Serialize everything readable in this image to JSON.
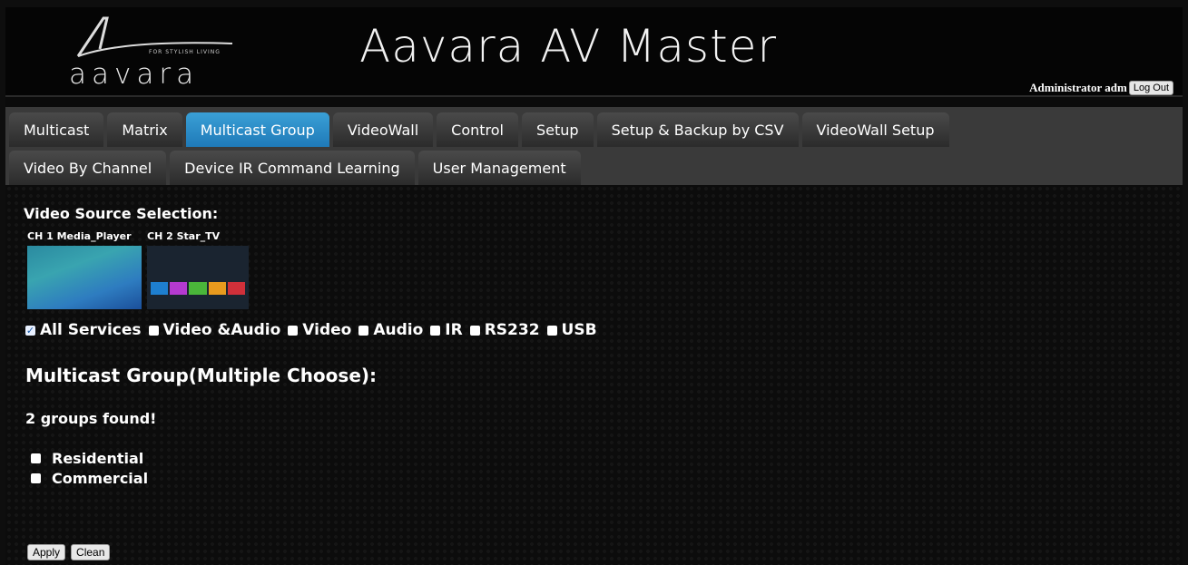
{
  "header": {
    "logo_text": "aavara",
    "logo_tagline": "FOR STYLISH LIVING",
    "title": "Aavara AV Master",
    "admin_text": "Administrator adm",
    "logout_label": "Log Out"
  },
  "tabs": {
    "row1": [
      "Multicast",
      "Matrix",
      "Multicast Group",
      "VideoWall",
      "Control",
      "Setup",
      "Setup & Backup by CSV",
      "VideoWall Setup"
    ],
    "row2": [
      "Video By Channel",
      "Device IR Command Learning",
      "User Management"
    ],
    "active": "Multicast Group"
  },
  "main": {
    "video_source_label": "Video Source Selection:",
    "channels": [
      {
        "label": "CH 1 Media_Player"
      },
      {
        "label": "CH 2 Star_TV"
      }
    ],
    "services": [
      {
        "label": "All Services",
        "checked": true
      },
      {
        "label": "Video &Audio",
        "checked": false
      },
      {
        "label": "Video",
        "checked": false
      },
      {
        "label": "Audio",
        "checked": false
      },
      {
        "label": "IR",
        "checked": false
      },
      {
        "label": "RS232",
        "checked": false
      },
      {
        "label": "USB",
        "checked": false
      }
    ],
    "multicast_title": "Multicast Group(Multiple Choose):",
    "groups_found": "2 groups found!",
    "groups": [
      {
        "label": "Residential",
        "checked": false
      },
      {
        "label": "Commercial",
        "checked": false
      }
    ],
    "apply_label": "Apply",
    "clean_label": "Clean"
  },
  "colors": {
    "active_tab": "#2a8cc8",
    "tab_bar": "#3a3a3a"
  }
}
